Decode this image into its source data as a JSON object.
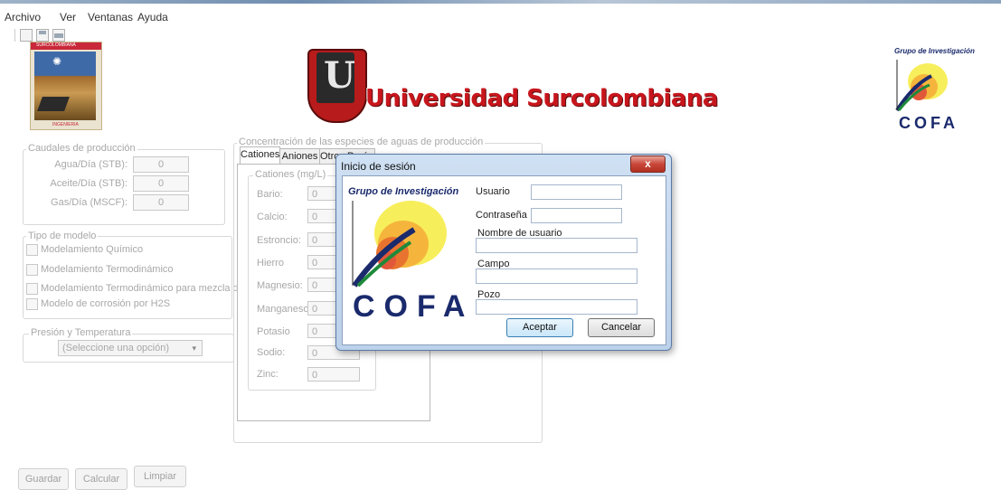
{
  "menu": [
    "Archivo",
    "Ver",
    "Ventanas",
    "Ayuda"
  ],
  "toolbar_icons": [
    "new-document-icon",
    "save-icon",
    "print-icon"
  ],
  "header": {
    "university_name": "Universidad Surcolombiana",
    "logo_letter": "U",
    "left_logo_text_top": "SURCOLOMBIANA",
    "left_logo_text_bottom": "INGENIERIA",
    "group_title": "Grupo de Investigación",
    "group_name": "COFA"
  },
  "caudales": {
    "legend": "Caudales de producción",
    "fields": [
      {
        "label": "Agua/Día (STB):",
        "value": "0"
      },
      {
        "label": "Aceite/Día (STB):",
        "value": "0"
      },
      {
        "label": "Gas/Día (MSCF):",
        "value": "0"
      }
    ]
  },
  "modelo": {
    "legend": "Tipo de modelo",
    "options": [
      "Modelamiento Químico",
      "Modelamiento Termodinámico",
      "Modelamiento Termodinámico para mezcla de aguas",
      "Modelo de corrosión por H2S"
    ]
  },
  "presion": {
    "legend": "Presión y Temperatura",
    "select_value": "(Seleccione una opción)"
  },
  "concentracion": {
    "legend": "Concentración de las especies de aguas de producción",
    "tabs": [
      "Cationes",
      "Aniones",
      "Otros Parámetros"
    ],
    "subgroup_legend": "Cationes (mg/L)",
    "fields": [
      {
        "label": "Bario:",
        "value": "0"
      },
      {
        "label": "Calcio:",
        "value": "0"
      },
      {
        "label": "Estroncio:",
        "value": "0"
      },
      {
        "label": "Hierro",
        "value": "0"
      },
      {
        "label": "Magnesio:",
        "value": "0"
      },
      {
        "label": "Manganeso:",
        "value": "0"
      },
      {
        "label": "Potasio",
        "value": "0"
      },
      {
        "label": "Sodio:",
        "value": "0"
      },
      {
        "label": "Zinc:",
        "value": "0"
      }
    ]
  },
  "buttons": {
    "guardar": "Guardar",
    "calcular": "Calcular",
    "limpiar": "Limpiar"
  },
  "dialog": {
    "title": "Inicio de sesión",
    "close_glyph": "x",
    "logo_title": "Grupo de Investigación",
    "logo_name": "COFA",
    "usuario_label": "Usuario",
    "usuario_value": "",
    "contrasena_label": "Contraseña",
    "contrasena_value": "",
    "nombre_label": "Nombre de usuario",
    "nombre_value": "",
    "campo_label": "Campo",
    "campo_value": "",
    "pozo_label": "Pozo",
    "pozo_value": "",
    "aceptar": "Aceptar",
    "cancelar": "Cancelar"
  },
  "colors": {
    "accent_red": "#cc1a1a",
    "disabled_text": "#a8a8a8",
    "dialog_frame": "#bcd1ea"
  }
}
